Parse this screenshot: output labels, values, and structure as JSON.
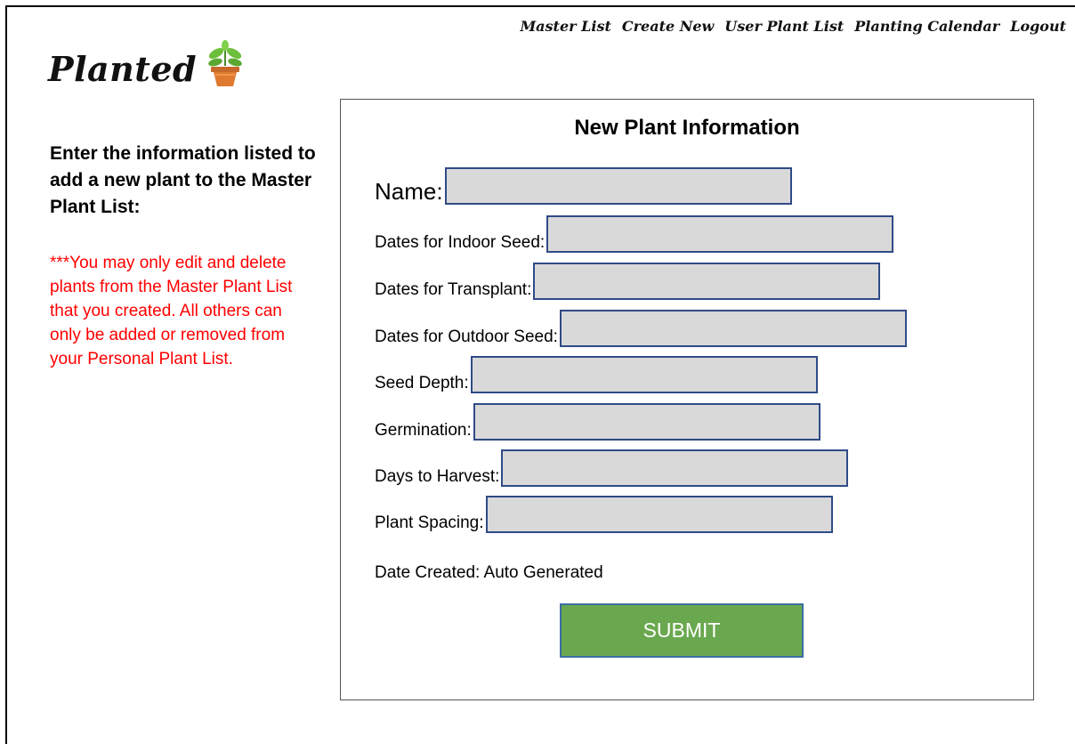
{
  "app": {
    "logo_text": "Planted",
    "logo_icon": "potted-plant-icon"
  },
  "nav": {
    "items": [
      {
        "label": "Master List"
      },
      {
        "label": "Create New"
      },
      {
        "label": "User Plant List"
      },
      {
        "label": "Planting Calendar"
      },
      {
        "label": "Logout"
      }
    ]
  },
  "sidebar": {
    "heading": "Enter the information listed to add a new plant to the Master Plant List:",
    "note": "***You may only edit and delete plants from the Master Plant List that you created. All others can only be added or removed from your Personal Plant List.",
    "note_color": "#ff0000"
  },
  "form": {
    "title": "New Plant Information",
    "fields": [
      {
        "label": "Name:",
        "value": ""
      },
      {
        "label": "Dates for Indoor Seed:",
        "value": ""
      },
      {
        "label": "Dates for Transplant:",
        "value": ""
      },
      {
        "label": "Dates for Outdoor Seed:",
        "value": ""
      },
      {
        "label": "Seed Depth:",
        "value": ""
      },
      {
        "label": "Germination:",
        "value": ""
      },
      {
        "label": "Days to Harvest:",
        "value": ""
      },
      {
        "label": "Plant Spacing:",
        "value": ""
      }
    ],
    "date_created": "Date Created: Auto Generated",
    "submit_label": "SUBMIT",
    "colors": {
      "field_bg": "#d9d9d9",
      "field_border": "#2f4b87",
      "submit_bg": "#6aa84f"
    }
  }
}
